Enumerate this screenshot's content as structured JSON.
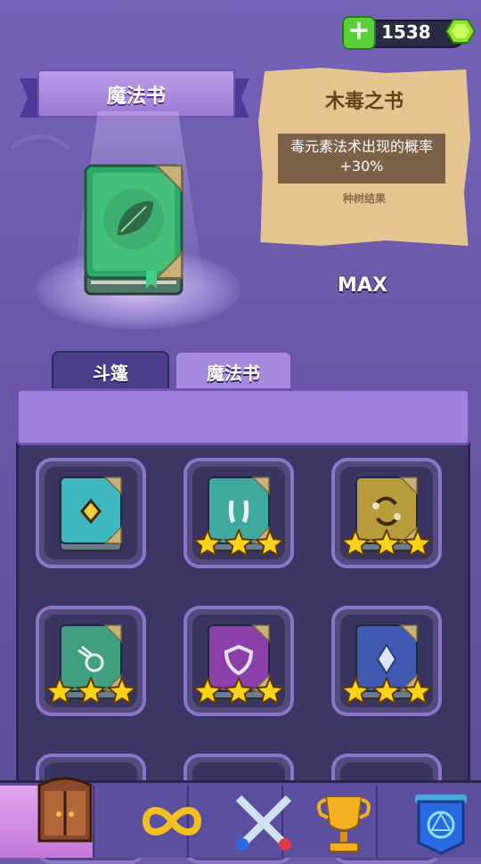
{
  "currency": {
    "amount": "1538"
  },
  "header": {
    "banner_title": "魔法书"
  },
  "detail": {
    "book_name": "木毒之书",
    "description": "毒元素法术出现的概率+30%",
    "subtitle": "种树结果",
    "level": "MAX"
  },
  "tabs": [
    {
      "label": "斗篷"
    },
    {
      "label": "魔法书"
    }
  ],
  "books": [
    {
      "icon": "diamond-book-icon",
      "color": "#3fb8c0",
      "stars": 0
    },
    {
      "icon": "fangs-book-icon",
      "color": "#3fa9a0",
      "stars": 3
    },
    {
      "icon": "swap-book-icon",
      "color": "#b89b3a",
      "stars": 3
    },
    {
      "icon": "comet-book-icon",
      "color": "#3f9f80",
      "stars": 3
    },
    {
      "icon": "shield-book-icon",
      "color": "#8b3fa9",
      "stars": 3
    },
    {
      "icon": "crystal-book-icon",
      "color": "#3f5ab0",
      "stars": 3
    }
  ],
  "nav": [
    {
      "icon": "wardrobe-icon"
    },
    {
      "icon": "infinity-icon"
    },
    {
      "icon": "crossed-swords-icon"
    },
    {
      "icon": "trophy-icon"
    },
    {
      "icon": "banner-map-icon"
    }
  ]
}
